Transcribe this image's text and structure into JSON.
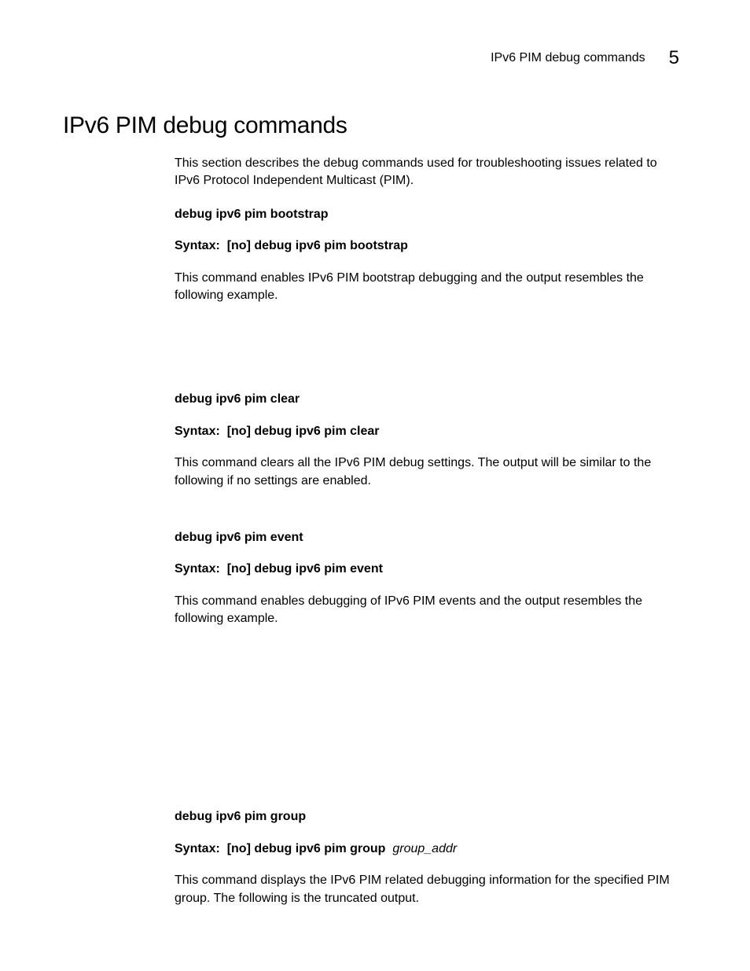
{
  "header": {
    "runningTitle": "IPv6 PIM debug commands",
    "chapterNumber": "5"
  },
  "sectionTitle": "IPv6 PIM debug commands",
  "intro": "This section describes the debug commands used for troubleshooting issues related to IPv6 Protocol Independent Multicast (PIM).",
  "syntaxLabel": "Syntax:",
  "commands": [
    {
      "name": "debug ipv6 pim bootstrap",
      "syntax": "[no] debug ipv6 pim bootstrap",
      "syntaxArg": "",
      "desc": "This command enables IPv6 PIM bootstrap debugging and the output resembles the following example."
    },
    {
      "name": "debug ipv6 pim clear",
      "syntax": "[no] debug ipv6 pim clear",
      "syntaxArg": "",
      "desc": "This command clears all the IPv6 PIM debug settings. The output will be similar to the following if no settings are enabled."
    },
    {
      "name": "debug ipv6 pim event",
      "syntax": "[no] debug ipv6 pim event",
      "syntaxArg": "",
      "desc": "This command enables debugging of IPv6 PIM events and the output resembles the following example."
    },
    {
      "name": "debug ipv6 pim group",
      "syntax": "[no] debug ipv6 pim group",
      "syntaxArg": "group_addr",
      "desc": "This command displays the IPv6 PIM related debugging information for the specified PIM group. The following is the truncated output."
    }
  ]
}
